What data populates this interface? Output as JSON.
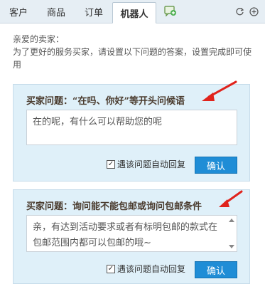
{
  "tabs": [
    {
      "label": "客户"
    },
    {
      "label": "商品"
    },
    {
      "label": "订单"
    },
    {
      "label": "机器人",
      "active": true
    }
  ],
  "toolbar": {
    "chat_icon": "chat-plus-icon",
    "refresh_icon": "refresh-icon",
    "add_icon": "add-icon"
  },
  "intro": {
    "line1": "亲爱的卖家：",
    "line2": "为了更好的服务买家，请设置以下问题的答案，设置完成即可使用"
  },
  "panels": [
    {
      "question": "买家问题：“在吗、你好”等开头问候语",
      "answer": "在的呢，有什么可以帮助您的呢",
      "auto_reply_label": "遇该问题自动回复",
      "auto_reply_checked": true,
      "confirm_label": "确认"
    },
    {
      "question": "买家问题：询问能不能包邮或询问包邮条件",
      "answer": "亲，有达到活动要求或者有标明包邮的款式在包邮范围内都可以包邮的哦~",
      "auto_reply_label": "遇该问题自动回复",
      "auto_reply_checked": true,
      "confirm_label": "确认"
    }
  ],
  "colors": {
    "panel_bg": "#dff0f9",
    "confirm_bg": "#1f8dd6",
    "arrow": "#e0231c"
  }
}
